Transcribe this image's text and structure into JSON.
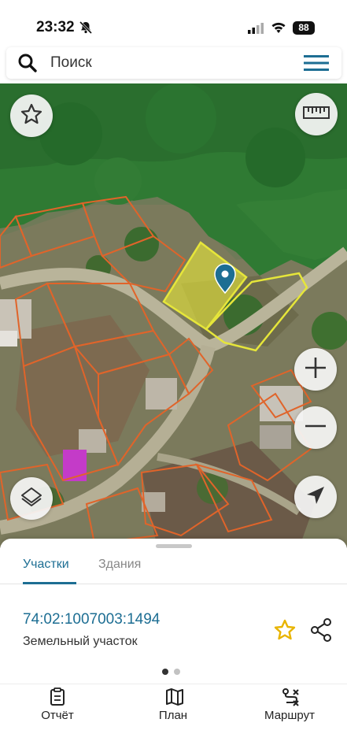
{
  "status_bar": {
    "time": "23:32",
    "battery": "88",
    "icons": [
      "bell-slash-icon",
      "signal-icon",
      "wifi-icon",
      "battery-icon"
    ]
  },
  "search": {
    "placeholder": "Поиск",
    "icons": [
      "search-icon",
      "menu-icon"
    ]
  },
  "map": {
    "controls": [
      "star-outline-icon",
      "ruler-icon",
      "plus-icon",
      "minus-icon",
      "layers-icon",
      "navigation-arrow-icon"
    ],
    "colors": {
      "parcel_border": "#e0642a",
      "selected_fill": "#e6e63a",
      "building_highlight": "#c43bc8",
      "pin": "#1d6e93",
      "forest": "#2f7a33"
    }
  },
  "sheet": {
    "tabs": [
      {
        "label": "Участки",
        "active": true
      },
      {
        "label": "Здания",
        "active": false
      }
    ],
    "parcel": {
      "cadastral_number": "74:02:1007003:1494",
      "type": "Земельный участок"
    },
    "pager": {
      "count": 2,
      "current": 1
    },
    "colors": {
      "accent": "#1d6e93",
      "star": "#e8b400"
    }
  },
  "bottom_nav": {
    "items": [
      {
        "label": "Отчёт",
        "icon": "clipboard-icon"
      },
      {
        "label": "План",
        "icon": "map-icon"
      },
      {
        "label": "Маршрут",
        "icon": "route-icon"
      }
    ]
  }
}
